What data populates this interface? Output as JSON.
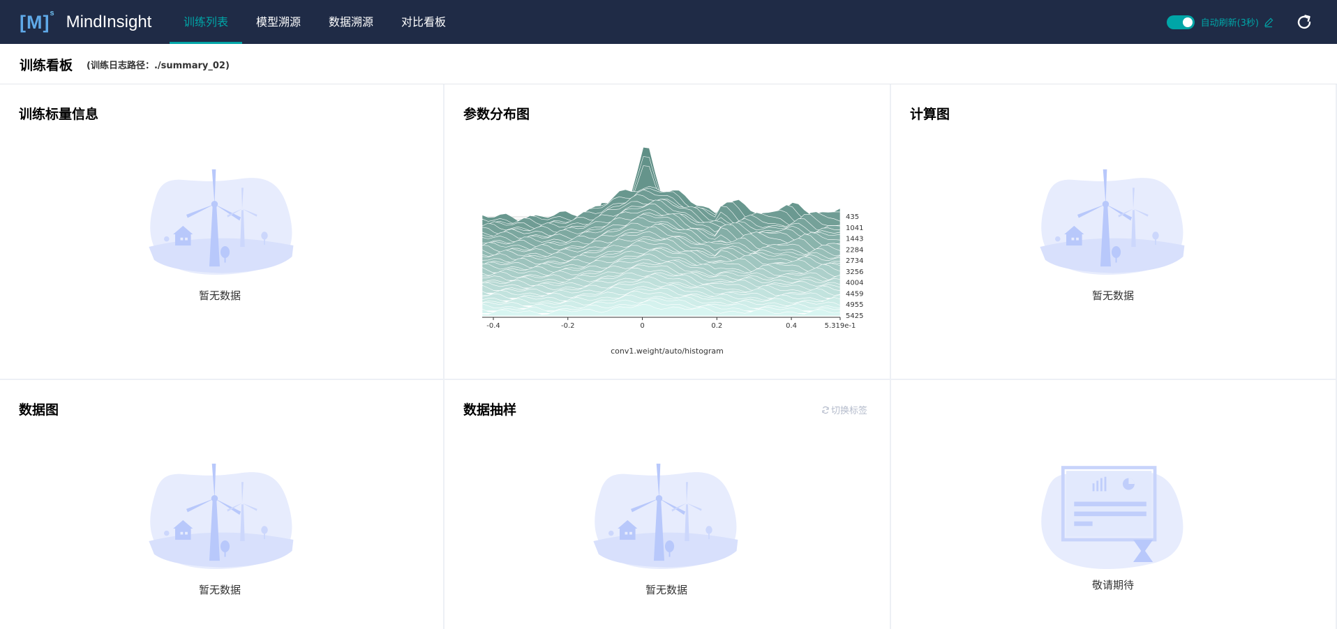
{
  "app": {
    "brand_mark": "[M]",
    "brand_sup": "s",
    "brand_name": "MindInsight"
  },
  "nav": {
    "items": [
      "训练列表",
      "模型溯源",
      "数据溯源",
      "对比看板"
    ],
    "active_index": 0
  },
  "top_right": {
    "auto_refresh_on": true,
    "auto_refresh_label": "自动刷新(3秒)",
    "edit_icon": "pen-icon",
    "refresh_icon": "refresh-icon"
  },
  "header": {
    "title": "训练看板",
    "path_label": "(训练日志路径：./summary_02)"
  },
  "cards": {
    "scalar": {
      "title": "训练标量信息",
      "empty_text": "暂无数据"
    },
    "histogram": {
      "title": "参数分布图",
      "chart_caption": "conv1.weight/auto/histogram"
    },
    "graph": {
      "title": "计算图",
      "empty_text": "暂无数据"
    },
    "dataset_graph": {
      "title": "数据图",
      "empty_text": "暂无数据"
    },
    "images": {
      "title": "数据抽样",
      "empty_text": "暂无数据",
      "switch_label": "切换标签"
    },
    "coming": {
      "empty_text": "敬请期待"
    }
  },
  "colors": {
    "topbar": "#1f2b46",
    "accent": "#00a5a7",
    "ridge_dark": "#5f8f86",
    "ridge_light": "#d8f5f1"
  },
  "chart_data": {
    "type": "area",
    "title": "conv1.weight/auto/histogram",
    "x_ticks": [
      "-0.4",
      "-0.2",
      "0",
      "0.2",
      "0.4",
      "5.319e-1"
    ],
    "x_range": [
      -0.43,
      0.531
    ],
    "step_labels": [
      "435",
      "1041",
      "1443",
      "2284",
      "2734",
      "3256",
      "4004",
      "4459",
      "4955",
      "5425"
    ],
    "peak_x": 0.0,
    "peak_step": "435"
  }
}
